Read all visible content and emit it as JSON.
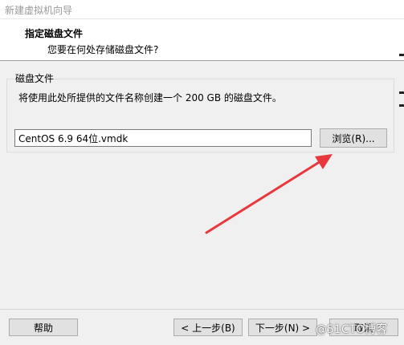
{
  "window": {
    "title": "新建虚拟机向导"
  },
  "header": {
    "heading": "指定磁盘文件",
    "subheading": "您要在何处存储磁盘文件?"
  },
  "disk_file": {
    "group_label": "磁盘文件",
    "description": "将使用此处所提供的文件名称创建一个 200 GB 的磁盘文件。",
    "filename_value": "CentOS 6.9 64位.vmdk",
    "browse_label": "浏览(R)..."
  },
  "footer": {
    "help_label": "帮助",
    "back_label": "< 上一步(B)",
    "next_label": "下一步(N) >",
    "cancel_label": "取消"
  },
  "annotation": {
    "arrow_color": "#e8383d"
  },
  "watermark": {
    "text": "@51CTO博客"
  }
}
